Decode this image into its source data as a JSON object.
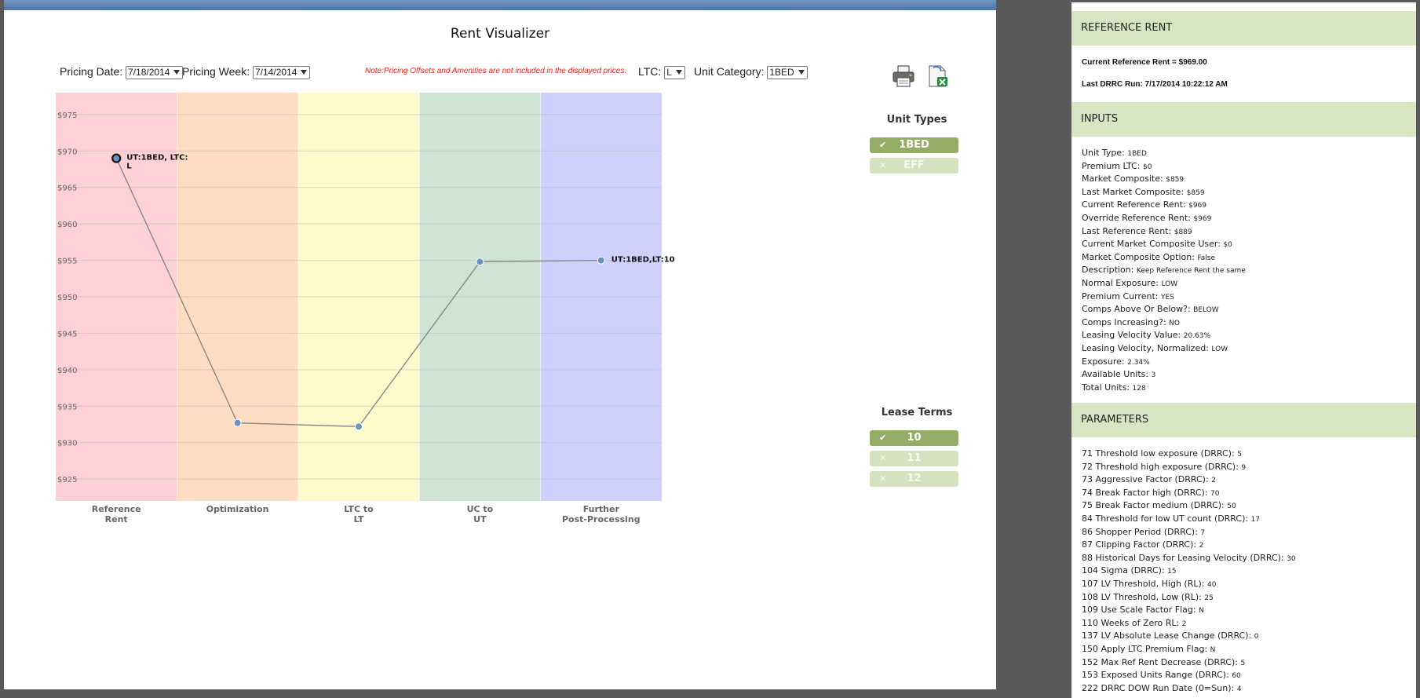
{
  "title": "Rent Visualizer",
  "controls": {
    "pricing_date_label": "Pricing Date:",
    "pricing_date_value": "7/18/2014",
    "pricing_week_label": "Pricing Week:",
    "pricing_week_value": "7/14/2014",
    "note": "Note:Pricing Offsets and Amenities are not included in the displayed prices.",
    "ltc_label": "LTC:",
    "ltc_value": "L",
    "unit_category_label": "Unit Category:",
    "unit_category_value": "1BED"
  },
  "icons": [
    "printer-icon",
    "excel-export-icon",
    "check-icon",
    "x-icon"
  ],
  "chart_data": {
    "type": "line",
    "categories": [
      "Reference Rent",
      "Optimization",
      "LTC to LT",
      "UC to UT",
      "Further Post-Processing"
    ],
    "series": [
      {
        "values": [
          969,
          932.7,
          932.2,
          954.8,
          955
        ]
      }
    ],
    "yticks": [
      "$925",
      "$930",
      "$935",
      "$940",
      "$945",
      "$950",
      "$955",
      "$960",
      "$965",
      "$970",
      "$975"
    ],
    "ylim": [
      922,
      978
    ],
    "point_labels": [
      {
        "index": 0,
        "text": "UT:1BED, LTC:",
        "text2": "L"
      },
      {
        "index": 4,
        "text": "UT:1BED,LT:10",
        "text2": ""
      }
    ],
    "band_colors": [
      "#ffd0d6",
      "#ffdcc2",
      "#fffacb",
      "#cfe4d5",
      "#cfd0fc"
    ],
    "line_color": "#888888",
    "point_color": "#6a94bf"
  },
  "unit_types": {
    "title": "Unit Types",
    "items": [
      {
        "label": "1BED",
        "mark": "✔",
        "selected": true
      },
      {
        "label": "EFF",
        "mark": "✕",
        "selected": false
      }
    ]
  },
  "lease_terms": {
    "title": "Lease Terms",
    "items": [
      {
        "label": "10",
        "mark": "✔",
        "selected": true
      },
      {
        "label": "11",
        "mark": "✕",
        "selected": false
      },
      {
        "label": "12",
        "mark": "✕",
        "selected": false
      }
    ]
  },
  "reference_rent": {
    "header": "REFERENCE RENT",
    "current": "Current Reference Rent = $969.00",
    "last_run": "Last DRRC Run: 7/17/2014 10:22:12 AM"
  },
  "inputs": {
    "header": "INPUTS",
    "rows": [
      {
        "k": "Unit Type:",
        "v": "1BED"
      },
      {
        "k": "Premium LTC:",
        "v": "$0"
      },
      {
        "k": "Market Composite:",
        "v": "$859"
      },
      {
        "k": "Last Market Composite:",
        "v": "$859"
      },
      {
        "k": "Current Reference Rent:",
        "v": "$969"
      },
      {
        "k": "Override Reference Rent:",
        "v": "$969"
      },
      {
        "k": "Last Reference Rent:",
        "v": "$889"
      },
      {
        "k": "Current Market Composite User:",
        "v": "$0"
      },
      {
        "k": "Market Composite Option:",
        "v": "False"
      },
      {
        "k": "Description:",
        "v": "Keep Reference Rent the same"
      },
      {
        "k": "Normal Exposure:",
        "v": "LOW"
      },
      {
        "k": "Premium Current:",
        "v": "YES"
      },
      {
        "k": "Comps Above Or Below?:",
        "v": "BELOW"
      },
      {
        "k": "Comps Increasing?:",
        "v": "NO"
      },
      {
        "k": "Leasing Velocity Value:",
        "v": "20.63%"
      },
      {
        "k": "Leasing Velocity, Normalized:",
        "v": "LOW"
      },
      {
        "k": "Exposure:",
        "v": "2.34%"
      },
      {
        "k": "Available Units:",
        "v": "3"
      },
      {
        "k": "Total Units:",
        "v": "128"
      }
    ]
  },
  "parameters": {
    "header": "PARAMETERS",
    "rows": [
      {
        "k": "71 Threshold low exposure (DRRC):",
        "v": "5"
      },
      {
        "k": "72 Threshold high exposure (DRRC):",
        "v": "9"
      },
      {
        "k": "73 Aggressive Factor (DRRC):",
        "v": "2"
      },
      {
        "k": "74 Break Factor high (DRRC):",
        "v": "70"
      },
      {
        "k": "75 Break Factor medium (DRRC):",
        "v": "50"
      },
      {
        "k": "84 Threshold for low UT count (DRRC):",
        "v": "17"
      },
      {
        "k": "86 Shopper Period (DRRC):",
        "v": "7"
      },
      {
        "k": "87 Clipping Factor (DRRC):",
        "v": "2"
      },
      {
        "k": "88 Historical Days for Leasing Velocity (DRRC):",
        "v": "30"
      },
      {
        "k": "104 Sigma (DRRC):",
        "v": "15"
      },
      {
        "k": "107 LV Threshold, High (RL):",
        "v": "40"
      },
      {
        "k": "108 LV Threshold, Low (RL):",
        "v": "25"
      },
      {
        "k": "109 Use Scale Factor Flag:",
        "v": "N"
      },
      {
        "k": "110 Weeks of Zero RL:",
        "v": "2"
      },
      {
        "k": "137 LV Absolute Lease Change (DRRC):",
        "v": "0"
      },
      {
        "k": "150 Apply LTC Premium Flag:",
        "v": "N"
      },
      {
        "k": "152 Max Ref Rent Decrease (DRRC):",
        "v": "5"
      },
      {
        "k": "153 Exposed Units Range (DRRC):",
        "v": "60"
      },
      {
        "k": "222 DRRC DOW Run Date (0=Sun):",
        "v": "4"
      }
    ]
  }
}
